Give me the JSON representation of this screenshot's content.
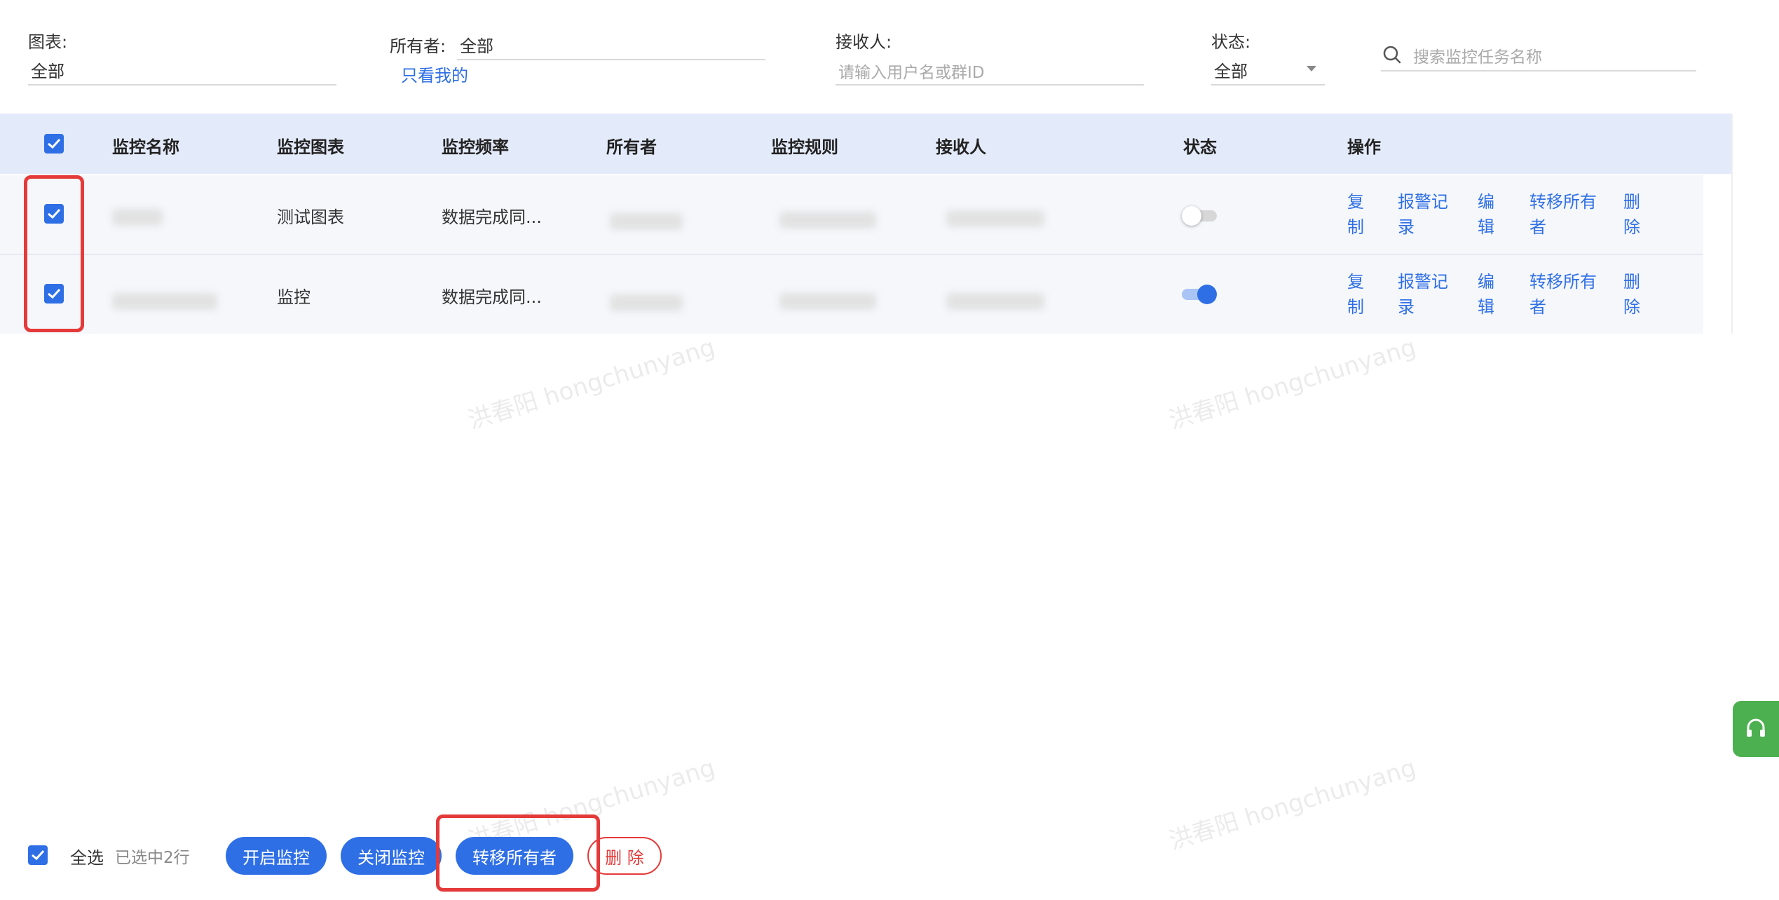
{
  "filters": {
    "chart": {
      "label": "图表:",
      "value": "全部"
    },
    "owner": {
      "label": "所有者:",
      "value": "全部",
      "only_mine": "只看我的"
    },
    "receiver": {
      "label": "接收人:",
      "placeholder": "请输入用户名或群ID"
    },
    "status": {
      "label": "状态:",
      "value": "全部"
    },
    "search": {
      "placeholder": "搜索监控任务名称"
    }
  },
  "table": {
    "headers": {
      "name": "监控名称",
      "chart": "监控图表",
      "frequency": "监控频率",
      "owner": "所有者",
      "rule": "监控规则",
      "receiver": "接收人",
      "status": "状态",
      "actions": "操作"
    },
    "rows": [
      {
        "chart": "测试图表",
        "frequency": "数据完成同...",
        "status_on": false,
        "selected": true
      },
      {
        "chart": "监控",
        "frequency": "数据完成同...",
        "status_on": true,
        "selected": true
      }
    ],
    "actions": {
      "copy": "复制",
      "alert_log": "报警记录",
      "edit": "编辑",
      "transfer": "转移所有者",
      "delete": "删除"
    }
  },
  "watermark": "洪春阳 hongchunyang",
  "bottom": {
    "select_all": "全选",
    "selected_count": "已选中2行",
    "enable": "开启监控",
    "disable": "关闭监控",
    "transfer": "转移所有者",
    "delete": "删 除"
  },
  "colors": {
    "primary": "#2f6fe6",
    "danger": "#e53a3a",
    "header_bg": "#e3eaf9",
    "help": "#4caf50"
  }
}
